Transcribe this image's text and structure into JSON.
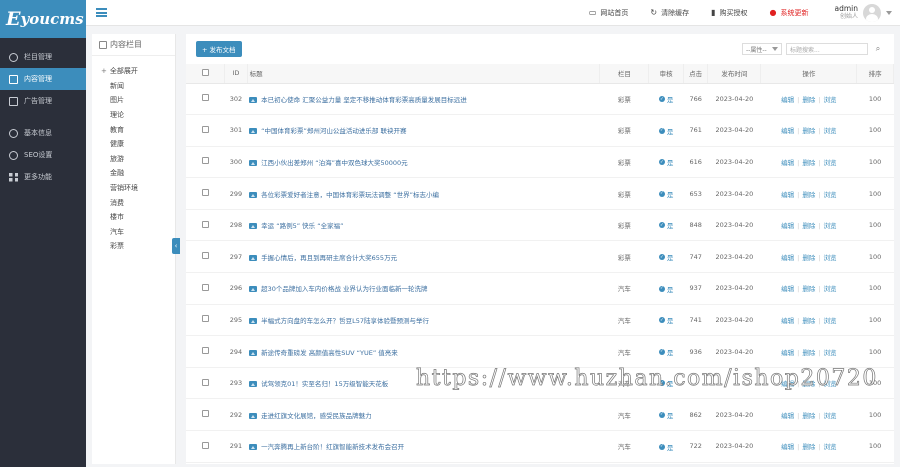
{
  "app": {
    "logo_text": "youcms",
    "logo_letter": "E"
  },
  "sidebar": {
    "items": [
      {
        "label": "栏目管理",
        "icon": "gear-icon"
      },
      {
        "label": "内容管理",
        "icon": "document-icon",
        "active": true
      },
      {
        "label": "广告管理",
        "icon": "image-icon"
      },
      {
        "label": "基本信息",
        "icon": "gear-icon"
      },
      {
        "label": "SEO设置",
        "icon": "globe-icon"
      },
      {
        "label": "更多功能",
        "icon": "grid-icon"
      }
    ]
  },
  "topbar": {
    "links": [
      {
        "label": "网站首页",
        "icon": "monitor-icon",
        "glyph": "▭"
      },
      {
        "label": "清除缓存",
        "icon": "refresh-icon",
        "glyph": "↻"
      },
      {
        "label": "购买授权",
        "icon": "bookmark-icon",
        "glyph": "▮"
      },
      {
        "label": "系统更新",
        "icon": "alert-icon",
        "glyph": "●"
      }
    ],
    "user": {
      "name": "admin",
      "role": "创始人"
    }
  },
  "tree": {
    "title": "内容栏目",
    "root": "全部展开",
    "items": [
      "新闻",
      "图片",
      "理论",
      "教育",
      "健康",
      "旅游",
      "金融",
      "营销环境",
      "消费",
      "楼市",
      "汽车",
      "彩票"
    ]
  },
  "toolbar": {
    "add_label": "+ 发布文档",
    "attr_select": "--属性--",
    "search_placeholder": "标题搜索..."
  },
  "table": {
    "headers": {
      "id": "ID",
      "title": "标题",
      "column": "栏目",
      "review": "审核",
      "clicks": "点击",
      "date": "发布时间",
      "ops": "操作",
      "order": "排序"
    },
    "status_label": "是",
    "actions": {
      "edit": "编辑",
      "delete": "删除",
      "view": "浏览"
    },
    "rows": [
      {
        "id": "302",
        "title": "本已初心使命 汇聚公益力量 坚定不移推动体育彩票高质量发展目标远进",
        "column": "彩票",
        "clicks": "766",
        "date": "2023-04-20",
        "order": "100"
      },
      {
        "id": "301",
        "title": "“中国体育彩票”郑州河山公益活动进乐部 联袂开赛",
        "column": "彩票",
        "clicks": "761",
        "date": "2023-04-20",
        "order": "100"
      },
      {
        "id": "300",
        "title": "江西小伙出差郑州 “泊海”喜中双色球大奖50000元",
        "column": "彩票",
        "clicks": "616",
        "date": "2023-04-20",
        "order": "100"
      },
      {
        "id": "299",
        "title": "各位彩票爱好者注意，中国体育彩票玩法调整 “世界”标志小编",
        "column": "彩票",
        "clicks": "653",
        "date": "2023-04-20",
        "order": "100"
      },
      {
        "id": "298",
        "title": "幸运 “路例5” 快乐 “全家福”",
        "column": "彩票",
        "clicks": "848",
        "date": "2023-04-20",
        "order": "100"
      },
      {
        "id": "297",
        "title": "手握心情后，再且到再研主席合计大奖655万元",
        "column": "彩票",
        "clicks": "747",
        "date": "2023-04-20",
        "order": "100"
      },
      {
        "id": "296",
        "title": "超30个品牌加入车内价格战 业界认为行业面临新一轮洗牌",
        "column": "汽车",
        "clicks": "937",
        "date": "2023-04-20",
        "order": "100"
      },
      {
        "id": "295",
        "title": "半幅式方向盘的车怎么开？哲豆L57陆享体验暨预测与举行",
        "column": "汽车",
        "clicks": "741",
        "date": "2023-04-20",
        "order": "100"
      },
      {
        "id": "294",
        "title": "新途传奇重磅发 高颜值高性SUV “YUE” 值亮来",
        "column": "汽车",
        "clicks": "936",
        "date": "2023-04-20",
        "order": "100"
      },
      {
        "id": "293",
        "title": "试驾领克01！实至名归！15万级智能天花板",
        "column": "汽车",
        "clicks": "",
        "date": "",
        "order": "100"
      },
      {
        "id": "292",
        "title": "走进红旗文化展馆，感受民族品牌魅力",
        "column": "汽车",
        "clicks": "862",
        "date": "2023-04-20",
        "order": "100"
      },
      {
        "id": "291",
        "title": "一汽奔腾再上新台阶！红旗智能新技术发布会召开",
        "column": "汽车",
        "clicks": "722",
        "date": "2023-04-20",
        "order": "100"
      }
    ]
  },
  "watermark": "https://www.huzhan.com/ishop20720"
}
